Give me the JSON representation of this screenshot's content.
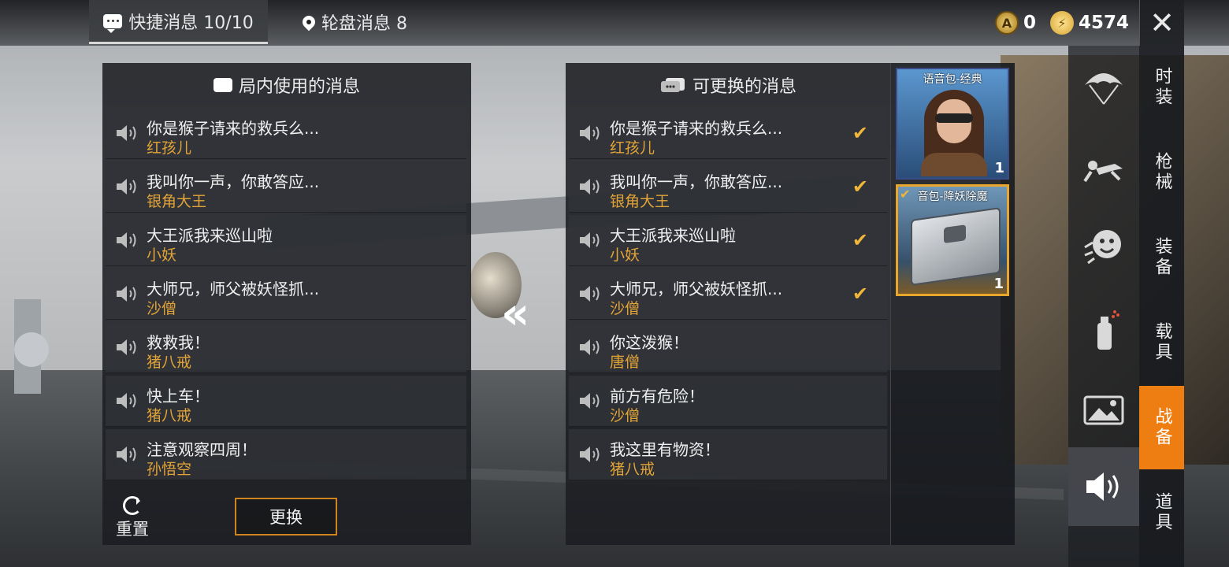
{
  "tabs": {
    "quick": {
      "label": "快捷消息 10/10"
    },
    "wheel": {
      "label": "轮盘消息 8"
    }
  },
  "currency": {
    "coin_a_value": "0",
    "coin_b_value": "4574",
    "coin_a_glyph": "A",
    "coin_b_glyph": "⚡"
  },
  "close_glyph": "✕",
  "left_panel": {
    "title": "局内使用的消息",
    "messages": [
      {
        "text": "你是猴子请来的救兵么...",
        "speaker": "红孩儿"
      },
      {
        "text": "我叫你一声，你敢答应...",
        "speaker": "银角大王"
      },
      {
        "text": "大王派我来巡山啦",
        "speaker": "小妖"
      },
      {
        "text": "大师兄，师父被妖怪抓...",
        "speaker": "沙僧"
      },
      {
        "text": "救救我！",
        "speaker": "猪八戒"
      },
      {
        "text": "快上车！",
        "speaker": "猪八戒"
      },
      {
        "text": "注意观察四周！",
        "speaker": "孙悟空"
      }
    ],
    "reset_label": "重置",
    "swap_label": "更换"
  },
  "swap_arrow": "«",
  "right_panel": {
    "title": "可更换的消息",
    "messages": [
      {
        "text": "你是猴子请来的救兵么...",
        "speaker": "红孩儿",
        "check": "✔"
      },
      {
        "text": "我叫你一声，你敢答应...",
        "speaker": "银角大王",
        "check": "✔"
      },
      {
        "text": "大王派我来巡山啦",
        "speaker": "小妖",
        "check": "✔"
      },
      {
        "text": "大师兄，师父被妖怪抓...",
        "speaker": "沙僧",
        "check": "✔"
      },
      {
        "text": "你这泼猴！",
        "speaker": "唐僧",
        "check": ""
      },
      {
        "text": "前方有危险！",
        "speaker": "沙僧",
        "check": ""
      },
      {
        "text": "我这里有物资！",
        "speaker": "猪八戒",
        "check": ""
      }
    ]
  },
  "voice_packs": [
    {
      "name": "语音包-经典",
      "count": "1",
      "tick": ""
    },
    {
      "name": "音包-降妖除魔",
      "count": "1",
      "tick": "✔"
    }
  ],
  "categories": [
    {
      "label": "时装"
    },
    {
      "label": "枪械"
    },
    {
      "label": "装备"
    },
    {
      "label": "载具"
    },
    {
      "label": "战备"
    },
    {
      "label": "道具"
    }
  ],
  "colors": {
    "accent": "#ee7d12",
    "speaker_name": "#e3a437",
    "check": "#f0b63a"
  },
  "sidebar_icons": [
    "parachute-icon",
    "skydiver-icon",
    "emote-icon",
    "spray-icon",
    "gallery-icon",
    "voice-icon"
  ]
}
